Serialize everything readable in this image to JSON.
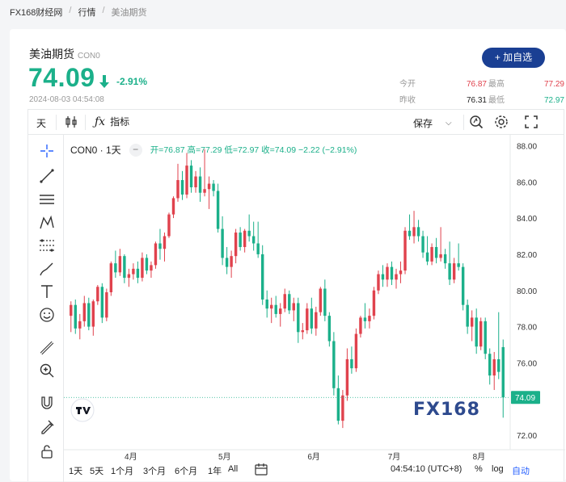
{
  "breadcrumb": [
    "FX168财经网",
    "行情",
    "美油期货"
  ],
  "instrument": {
    "name": "美油期货",
    "code": "CON0",
    "price": "74.09",
    "change_pct": "-2.91%",
    "timestamp": "2024-08-03 04:54:08"
  },
  "add_button": "+ 加自选",
  "quotes": {
    "open_label": "今开",
    "open": "76.87",
    "high_label": "最高",
    "high": "77.29",
    "prev_label": "昨收",
    "prev": "76.31",
    "low_label": "最低",
    "low": "72.97"
  },
  "toolbar": {
    "interval": "天",
    "indicators": "指标",
    "save": "保存"
  },
  "legend": {
    "symbol": "CON0 · 1天",
    "collapse": "−",
    "ohlc": "开=76.87 高=77.29 低=72.97 收=74.09 −2.22 (−2.91%)"
  },
  "ranges": [
    "1天",
    "5天",
    "1个月",
    "3个月",
    "6个月",
    "1年",
    "All"
  ],
  "clock": "04:54:10 (UTC+8)",
  "scale_buttons": [
    "%",
    "log",
    "自动"
  ],
  "watermark": "FX168",
  "colors": {
    "up": "#e0424d",
    "down": "#1bb08a",
    "accent": "#1a3f93"
  },
  "chart_data": {
    "type": "candlestick",
    "x_ticks": [
      "4月",
      "5月",
      "6月",
      "7月",
      "8月"
    ],
    "y_ticks": [
      "88.00",
      "86.00",
      "84.00",
      "82.00",
      "80.00",
      "78.00",
      "76.00",
      "74.00",
      "72.00"
    ],
    "ylim": [
      71.2,
      88.6
    ],
    "last_price": "74.09",
    "candles": [
      {
        "o": 78.6,
        "h": 79.4,
        "l": 77.7,
        "c": 79.2
      },
      {
        "o": 79.2,
        "h": 79.5,
        "l": 77.6,
        "c": 77.9
      },
      {
        "o": 77.9,
        "h": 78.7,
        "l": 77.3,
        "c": 78.3
      },
      {
        "o": 78.3,
        "h": 79.7,
        "l": 78.0,
        "c": 79.3
      },
      {
        "o": 79.3,
        "h": 79.6,
        "l": 77.8,
        "c": 78.0
      },
      {
        "o": 78.0,
        "h": 79.5,
        "l": 77.5,
        "c": 79.4
      },
      {
        "o": 79.4,
        "h": 80.3,
        "l": 79.2,
        "c": 80.2
      },
      {
        "o": 80.2,
        "h": 80.4,
        "l": 78.2,
        "c": 78.5
      },
      {
        "o": 78.5,
        "h": 80.1,
        "l": 78.3,
        "c": 79.9
      },
      {
        "o": 79.9,
        "h": 81.6,
        "l": 79.7,
        "c": 81.5
      },
      {
        "o": 81.5,
        "h": 82.2,
        "l": 80.7,
        "c": 81.0
      },
      {
        "o": 81.0,
        "h": 82.3,
        "l": 80.8,
        "c": 81.9
      },
      {
        "o": 81.9,
        "h": 82.0,
        "l": 80.4,
        "c": 80.7
      },
      {
        "o": 80.7,
        "h": 81.2,
        "l": 80.2,
        "c": 80.9
      },
      {
        "o": 80.9,
        "h": 81.5,
        "l": 80.6,
        "c": 81.2
      },
      {
        "o": 81.2,
        "h": 81.6,
        "l": 80.4,
        "c": 80.7
      },
      {
        "o": 80.7,
        "h": 82.1,
        "l": 80.5,
        "c": 81.8
      },
      {
        "o": 81.8,
        "h": 82.0,
        "l": 80.9,
        "c": 81.1
      },
      {
        "o": 81.1,
        "h": 81.6,
        "l": 80.7,
        "c": 81.4
      },
      {
        "o": 81.4,
        "h": 82.7,
        "l": 81.2,
        "c": 82.6
      },
      {
        "o": 82.6,
        "h": 83.4,
        "l": 81.7,
        "c": 82.3
      },
      {
        "o": 82.3,
        "h": 83.2,
        "l": 81.6,
        "c": 83.0
      },
      {
        "o": 83.0,
        "h": 84.3,
        "l": 82.9,
        "c": 84.2
      },
      {
        "o": 84.2,
        "h": 85.2,
        "l": 84.0,
        "c": 85.1
      },
      {
        "o": 85.1,
        "h": 87.0,
        "l": 84.9,
        "c": 86.1
      },
      {
        "o": 86.1,
        "h": 86.6,
        "l": 85.0,
        "c": 85.3
      },
      {
        "o": 85.3,
        "h": 87.6,
        "l": 85.1,
        "c": 86.9
      },
      {
        "o": 86.9,
        "h": 87.2,
        "l": 85.4,
        "c": 85.7
      },
      {
        "o": 85.7,
        "h": 86.6,
        "l": 85.4,
        "c": 86.3
      },
      {
        "o": 86.3,
        "h": 86.8,
        "l": 84.9,
        "c": 85.4
      },
      {
        "o": 85.4,
        "h": 87.8,
        "l": 85.2,
        "c": 85.6
      },
      {
        "o": 85.6,
        "h": 86.3,
        "l": 84.5,
        "c": 85.9
      },
      {
        "o": 85.9,
        "h": 86.1,
        "l": 85.2,
        "c": 85.5
      },
      {
        "o": 85.5,
        "h": 85.9,
        "l": 83.2,
        "c": 83.4
      },
      {
        "o": 83.4,
        "h": 84.1,
        "l": 81.4,
        "c": 81.8
      },
      {
        "o": 81.8,
        "h": 82.4,
        "l": 80.9,
        "c": 81.3
      },
      {
        "o": 81.3,
        "h": 82.2,
        "l": 80.7,
        "c": 81.9
      },
      {
        "o": 81.9,
        "h": 83.4,
        "l": 81.5,
        "c": 83.2
      },
      {
        "o": 83.2,
        "h": 83.5,
        "l": 82.2,
        "c": 82.4
      },
      {
        "o": 82.4,
        "h": 83.4,
        "l": 82.1,
        "c": 83.3
      },
      {
        "o": 83.3,
        "h": 84.2,
        "l": 82.7,
        "c": 83.0
      },
      {
        "o": 83.0,
        "h": 83.8,
        "l": 82.2,
        "c": 82.6
      },
      {
        "o": 82.6,
        "h": 83.8,
        "l": 81.8,
        "c": 82.0
      },
      {
        "o": 82.0,
        "h": 82.5,
        "l": 79.2,
        "c": 79.5
      },
      {
        "o": 79.5,
        "h": 80.0,
        "l": 78.5,
        "c": 79.0
      },
      {
        "o": 79.0,
        "h": 79.6,
        "l": 78.2,
        "c": 79.2
      },
      {
        "o": 79.2,
        "h": 79.7,
        "l": 78.5,
        "c": 78.7
      },
      {
        "o": 78.7,
        "h": 79.3,
        "l": 78.0,
        "c": 79.0
      },
      {
        "o": 79.0,
        "h": 80.1,
        "l": 78.8,
        "c": 79.8
      },
      {
        "o": 79.8,
        "h": 80.0,
        "l": 78.7,
        "c": 78.9
      },
      {
        "o": 78.9,
        "h": 79.6,
        "l": 78.3,
        "c": 79.3
      },
      {
        "o": 79.3,
        "h": 79.6,
        "l": 77.1,
        "c": 77.7
      },
      {
        "o": 77.7,
        "h": 78.2,
        "l": 77.3,
        "c": 77.8
      },
      {
        "o": 77.8,
        "h": 79.3,
        "l": 77.6,
        "c": 79.0
      },
      {
        "o": 79.0,
        "h": 79.6,
        "l": 77.6,
        "c": 77.9
      },
      {
        "o": 77.9,
        "h": 79.1,
        "l": 77.5,
        "c": 78.8
      },
      {
        "o": 78.8,
        "h": 80.2,
        "l": 78.6,
        "c": 80.1
      },
      {
        "o": 80.1,
        "h": 80.6,
        "l": 78.3,
        "c": 78.6
      },
      {
        "o": 78.6,
        "h": 78.8,
        "l": 76.9,
        "c": 77.2
      },
      {
        "o": 77.2,
        "h": 77.7,
        "l": 74.2,
        "c": 74.6
      },
      {
        "o": 74.6,
        "h": 75.3,
        "l": 72.6,
        "c": 72.8
      },
      {
        "o": 72.8,
        "h": 74.5,
        "l": 72.4,
        "c": 74.2
      },
      {
        "o": 74.2,
        "h": 76.8,
        "l": 73.9,
        "c": 76.2
      },
      {
        "o": 76.2,
        "h": 76.9,
        "l": 75.4,
        "c": 75.7
      },
      {
        "o": 75.7,
        "h": 77.9,
        "l": 75.5,
        "c": 77.6
      },
      {
        "o": 77.6,
        "h": 78.6,
        "l": 77.4,
        "c": 78.5
      },
      {
        "o": 78.5,
        "h": 79.3,
        "l": 77.9,
        "c": 78.3
      },
      {
        "o": 78.3,
        "h": 79.0,
        "l": 77.9,
        "c": 78.6
      },
      {
        "o": 78.6,
        "h": 80.2,
        "l": 78.4,
        "c": 80.0
      },
      {
        "o": 80.0,
        "h": 81.1,
        "l": 79.8,
        "c": 80.9
      },
      {
        "o": 80.9,
        "h": 81.4,
        "l": 80.2,
        "c": 80.6
      },
      {
        "o": 80.6,
        "h": 81.5,
        "l": 80.2,
        "c": 81.3
      },
      {
        "o": 81.3,
        "h": 81.6,
        "l": 80.3,
        "c": 80.6
      },
      {
        "o": 80.6,
        "h": 81.2,
        "l": 80.1,
        "c": 80.9
      },
      {
        "o": 80.9,
        "h": 81.6,
        "l": 80.4,
        "c": 81.1
      },
      {
        "o": 81.1,
        "h": 83.5,
        "l": 80.9,
        "c": 83.3
      },
      {
        "o": 83.3,
        "h": 84.2,
        "l": 82.8,
        "c": 83.0
      },
      {
        "o": 83.0,
        "h": 84.4,
        "l": 82.6,
        "c": 83.5
      },
      {
        "o": 83.5,
        "h": 83.9,
        "l": 82.7,
        "c": 83.0
      },
      {
        "o": 83.0,
        "h": 83.3,
        "l": 81.8,
        "c": 82.1
      },
      {
        "o": 82.1,
        "h": 83.0,
        "l": 81.4,
        "c": 81.6
      },
      {
        "o": 81.6,
        "h": 82.6,
        "l": 81.4,
        "c": 82.4
      },
      {
        "o": 82.4,
        "h": 82.9,
        "l": 81.5,
        "c": 81.8
      },
      {
        "o": 81.8,
        "h": 83.5,
        "l": 81.6,
        "c": 82.0
      },
      {
        "o": 82.0,
        "h": 82.3,
        "l": 81.2,
        "c": 81.5
      },
      {
        "o": 81.5,
        "h": 82.7,
        "l": 80.3,
        "c": 80.6
      },
      {
        "o": 80.6,
        "h": 81.8,
        "l": 80.4,
        "c": 81.5
      },
      {
        "o": 81.5,
        "h": 82.6,
        "l": 81.1,
        "c": 81.3
      },
      {
        "o": 81.3,
        "h": 81.5,
        "l": 78.9,
        "c": 79.2
      },
      {
        "o": 79.2,
        "h": 79.5,
        "l": 77.6,
        "c": 78.0
      },
      {
        "o": 78.0,
        "h": 78.9,
        "l": 77.2,
        "c": 78.5
      },
      {
        "o": 78.5,
        "h": 79.0,
        "l": 76.5,
        "c": 76.9
      },
      {
        "o": 76.9,
        "h": 78.5,
        "l": 76.7,
        "c": 78.3
      },
      {
        "o": 78.3,
        "h": 78.5,
        "l": 76.2,
        "c": 76.5
      },
      {
        "o": 76.5,
        "h": 76.8,
        "l": 74.8,
        "c": 75.3
      },
      {
        "o": 75.3,
        "h": 76.6,
        "l": 74.5,
        "c": 76.2
      },
      {
        "o": 76.2,
        "h": 78.8,
        "l": 75.1,
        "c": 75.5
      },
      {
        "o": 76.87,
        "h": 77.29,
        "l": 72.97,
        "c": 74.09
      }
    ]
  }
}
